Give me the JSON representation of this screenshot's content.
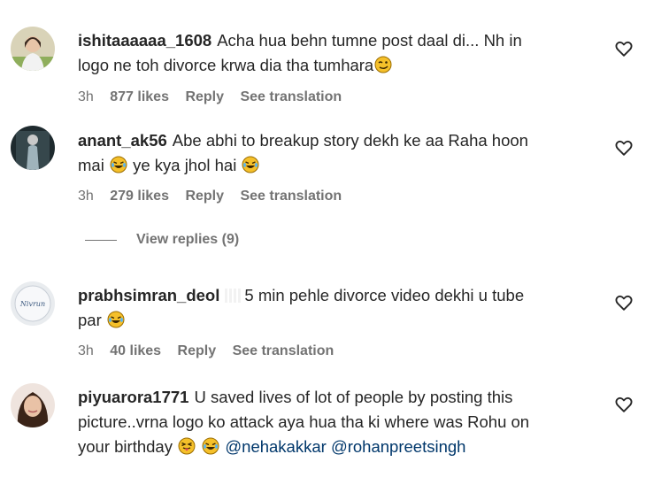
{
  "comments": [
    {
      "username": "ishitaaaaaa_1608",
      "line1": "Acha hua behn tumne post daal di... Nh in",
      "line2": "logo ne toh divorce krwa dia tha tumhara",
      "time": "3h",
      "likes": "877 likes",
      "reply": "Reply",
      "translate": "See translation",
      "emoji_icon": "smirk-face-icon"
    },
    {
      "username": "anant_ak56",
      "line1": "Abe abhi to breakup story dekh ke aa Raha hoon",
      "line2_a": "mai",
      "line2_b": "ye kya jhol hai",
      "time": "3h",
      "likes": "279 likes",
      "reply": "Reply",
      "translate": "See translation",
      "view_replies": "View replies (9)"
    },
    {
      "username": "prabhsimran_deol",
      "line1": "5 min pehle divorce video dekhi u tube",
      "line2": "par",
      "time": "3h",
      "likes": "40 likes",
      "reply": "Reply",
      "translate": "See translation",
      "avatar_text": "Nivrun"
    },
    {
      "username": "piyuarora1771",
      "line1": "U saved lives of lot of people by posting this",
      "line2": "picture..vrna logo ko attack aya hua tha ki where was Rohu on",
      "line3": "your birthday",
      "mention1": "@nehakakkar",
      "mention2": "@rohanpreetsingh"
    }
  ],
  "colors": {
    "text": "#262626",
    "secondary": "#737373",
    "mention": "#00376b",
    "emoji": "#f5c02a"
  }
}
